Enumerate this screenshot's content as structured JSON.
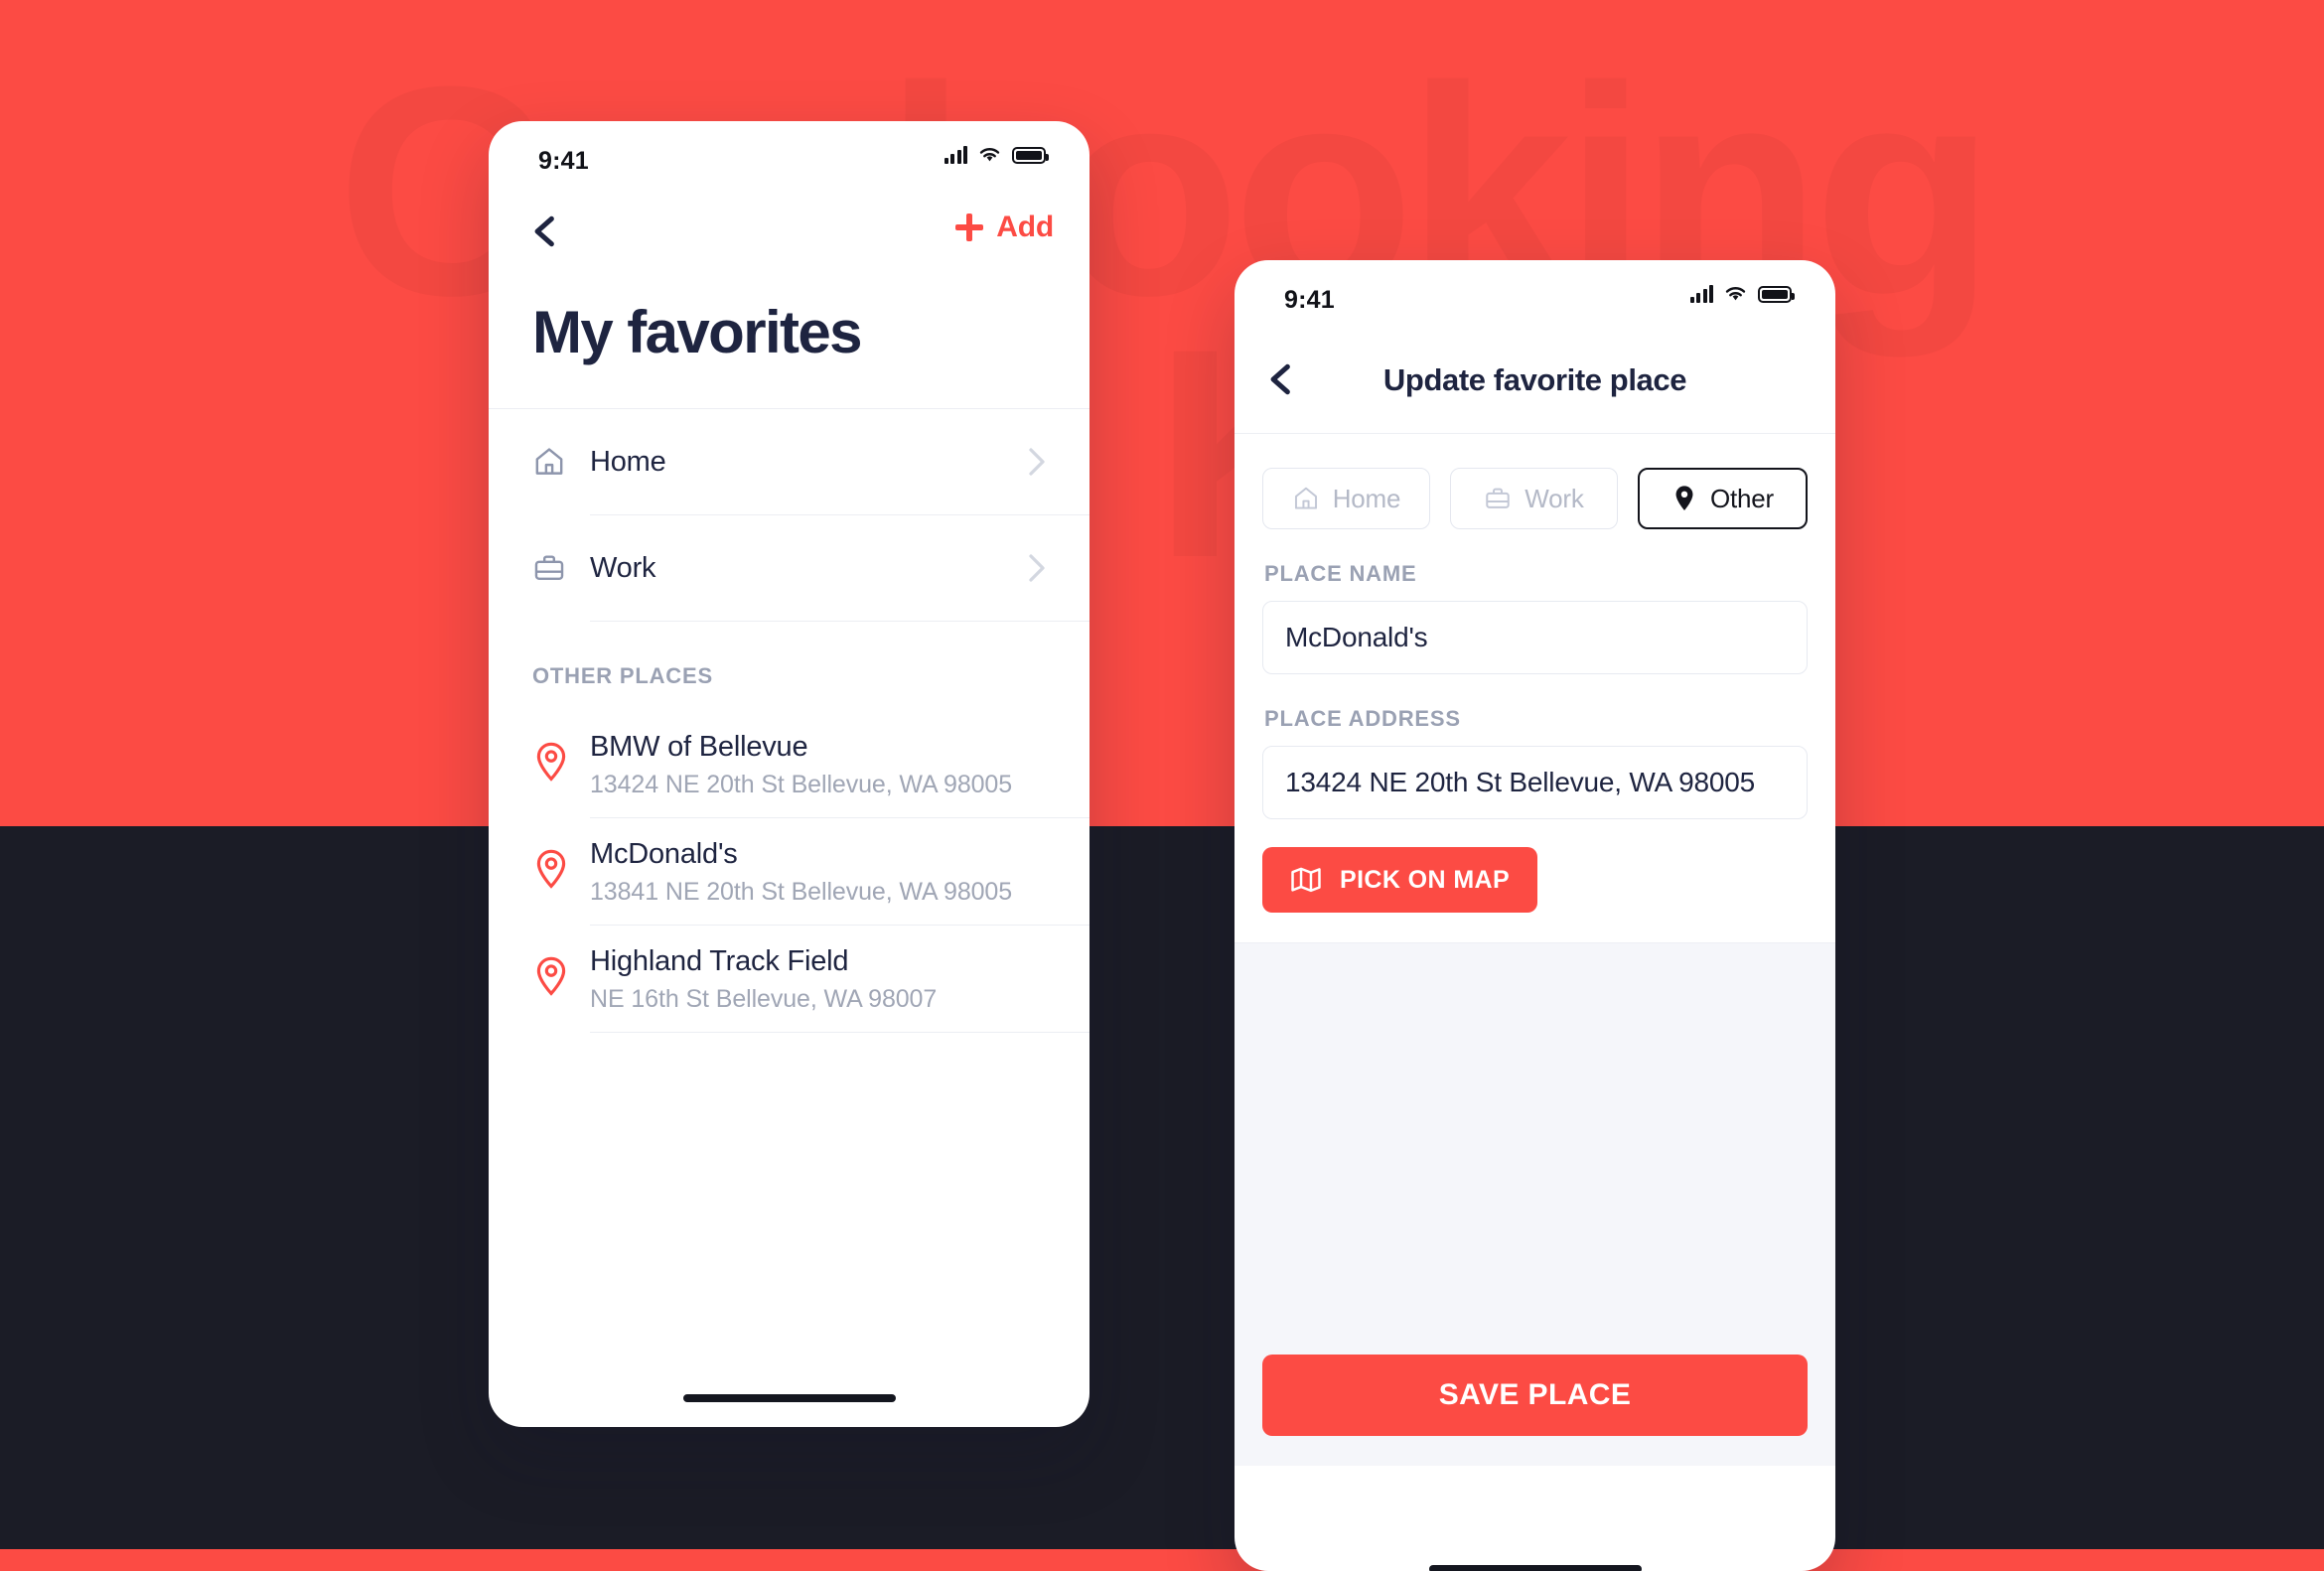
{
  "background": {
    "watermark_text": "Car booking\nUI Kit",
    "red": "#FC4B44",
    "dark": "#1B1C26"
  },
  "left_phone": {
    "status": {
      "time": "9:41",
      "signal_icon": "signal-bars-icon",
      "wifi_icon": "wifi-icon",
      "battery_icon": "battery-icon"
    },
    "nav": {
      "back_icon": "chevron-left-icon",
      "add_icon": "plus-icon",
      "add_label": "Add"
    },
    "title": "My favorites",
    "primary_items": [
      {
        "label": "Home",
        "icon": "home-icon",
        "chevron": "chevron-right-icon"
      },
      {
        "label": "Work",
        "icon": "briefcase-icon",
        "chevron": "chevron-right-icon"
      }
    ],
    "section_header": "OTHER PLACES",
    "places": [
      {
        "icon": "map-pin-icon",
        "name": "BMW of Bellevue",
        "address": "13424 NE 20th St Bellevue, WA 98005"
      },
      {
        "icon": "map-pin-icon",
        "name": "McDonald's",
        "address": "13841 NE 20th St Bellevue, WA 98005"
      },
      {
        "icon": "map-pin-icon",
        "name": "Highland Track Field",
        "address": "NE 16th St Bellevue, WA 98007"
      }
    ]
  },
  "right_phone": {
    "status": {
      "time": "9:41",
      "signal_icon": "signal-bars-icon",
      "wifi_icon": "wifi-icon",
      "battery_icon": "battery-icon"
    },
    "nav": {
      "back_icon": "chevron-left-icon",
      "title": "Update favorite place"
    },
    "type_chips": [
      {
        "label": "Home",
        "icon": "home-icon",
        "selected": false
      },
      {
        "label": "Work",
        "icon": "briefcase-icon",
        "selected": false
      },
      {
        "label": "Other",
        "icon": "map-pin-icon",
        "selected": true
      }
    ],
    "fields": {
      "place_name_label": "PLACE NAME",
      "place_name_value": "McDonald's",
      "place_address_label": "PLACE ADDRESS",
      "place_address_value": "13424 NE 20th St Bellevue, WA 98005"
    },
    "pick_on_map": {
      "label": "PICK ON MAP",
      "icon": "map-folded-icon"
    },
    "save": {
      "label": "SAVE PLACE"
    }
  }
}
